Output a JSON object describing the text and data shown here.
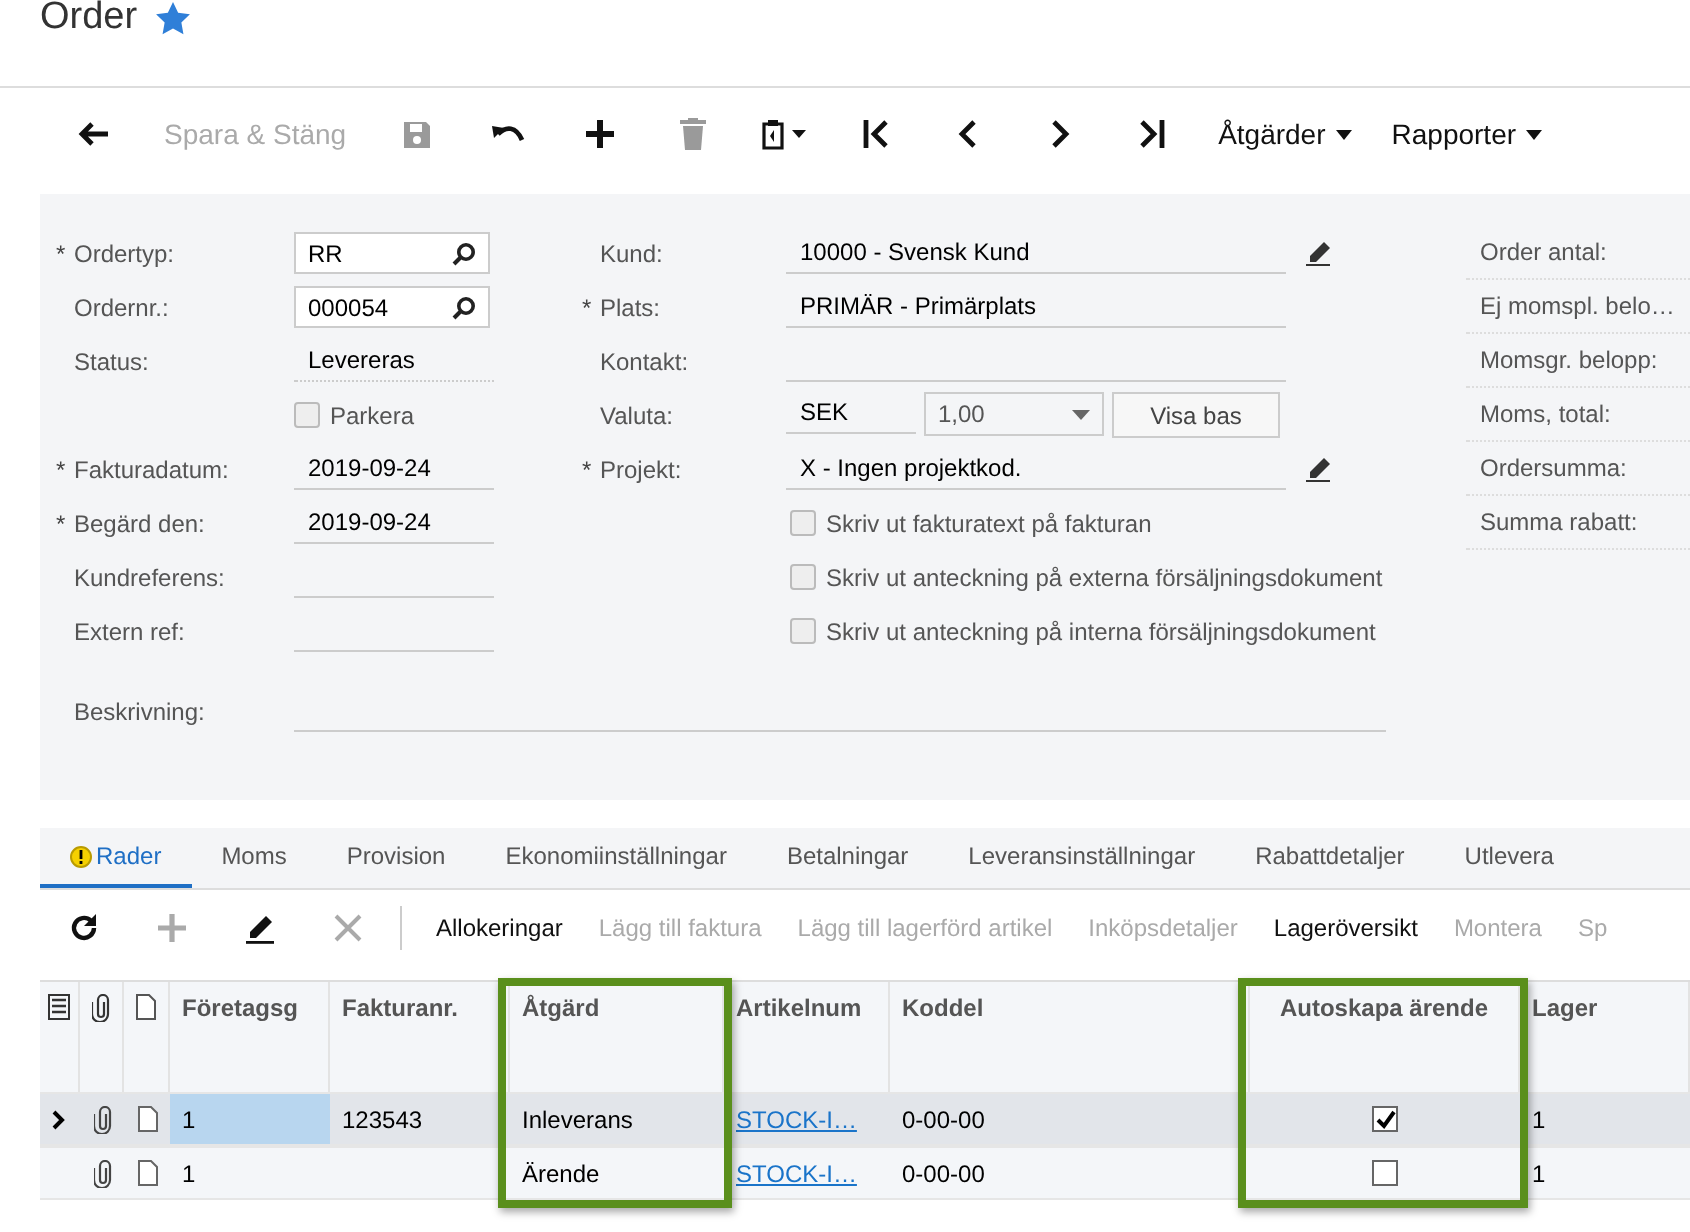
{
  "title": "Order",
  "starred": true,
  "toolbar": [
    {
      "kind": "back",
      "disabled": false
    },
    {
      "kind": "text",
      "label": "Spara & Stäng",
      "disabled": true
    },
    {
      "kind": "save",
      "disabled": true
    },
    {
      "kind": "undo",
      "disabled": false
    },
    {
      "kind": "add",
      "disabled": false
    },
    {
      "kind": "delete",
      "disabled": true
    },
    {
      "kind": "clipboard",
      "disabled": false
    },
    {
      "kind": "first",
      "disabled": false
    },
    {
      "kind": "prev",
      "disabled": false
    },
    {
      "kind": "next",
      "disabled": false
    },
    {
      "kind": "last",
      "disabled": false
    },
    {
      "kind": "menu",
      "label": "Åtgärder",
      "disabled": false
    },
    {
      "kind": "menu",
      "label": "Rapporter",
      "disabled": false
    }
  ],
  "form": {
    "left": [
      {
        "kind": "lookup",
        "label": "Ordertyp:",
        "required": true,
        "value": "RR"
      },
      {
        "kind": "lookup",
        "label": "Ordernr.:",
        "required": false,
        "value": "000054"
      },
      {
        "kind": "readonly",
        "label": "Status:",
        "required": false,
        "value": "Levereras"
      },
      {
        "kind": "checkbox",
        "label": "Parkera",
        "checked": false
      },
      {
        "kind": "input",
        "label": "Fakturadatum:",
        "required": true,
        "value": "2019-09-24"
      },
      {
        "kind": "input",
        "label": "Begärd den:",
        "required": true,
        "value": "2019-09-24"
      },
      {
        "kind": "input",
        "label": "Kundreferens:",
        "required": false
      },
      {
        "kind": "input",
        "label": "Extern ref:",
        "required": false
      }
    ],
    "middle": [
      {
        "kind": "input",
        "label": "Kund:",
        "required": false,
        "value": "10000 - Svensk Kund",
        "editable": true
      },
      {
        "kind": "input",
        "label": "Plats:",
        "required": true,
        "value": "PRIMÄR - Primärplats",
        "editable": false
      },
      {
        "kind": "input",
        "label": "Kontakt:",
        "required": false,
        "editable": false
      },
      {
        "kind": "currency",
        "label": "Valuta:",
        "required": false,
        "value": "SEK",
        "rate": "1,00",
        "button": "Visa bas"
      },
      {
        "kind": "input",
        "label": "Projekt:",
        "required": true,
        "value": "X - Ingen projektkod.",
        "editable": true
      },
      {
        "kind": "checkbox",
        "label": "Skriv ut fakturatext på fakturan",
        "checked": false
      },
      {
        "kind": "checkbox",
        "label": "Skriv ut anteckning på externa försäljningsdokument",
        "checked": false
      },
      {
        "kind": "checkbox",
        "label": "Skriv ut anteckning på interna försäljningsdokument",
        "checked": false
      }
    ],
    "right": [
      "Order antal:",
      "Ej momspl. belo…",
      "Momsgr. belopp:",
      "Moms, total:",
      "Ordersumma:",
      "Summa rabatt:"
    ],
    "description_label": "Beskrivning:",
    "required_marker": "*"
  },
  "tabs": [
    {
      "label": "Rader",
      "selected": true,
      "warning": true
    },
    {
      "label": "Moms",
      "selected": false,
      "warning": false
    },
    {
      "label": "Provision",
      "selected": false,
      "warning": false
    },
    {
      "label": "Ekonomiinställningar",
      "selected": false,
      "warning": false
    },
    {
      "label": "Betalningar",
      "selected": false,
      "warning": false
    },
    {
      "label": "Leveransinställningar",
      "selected": false,
      "warning": false
    },
    {
      "label": "Rabattdetaljer",
      "selected": false,
      "warning": false
    },
    {
      "label": "Utlevera",
      "selected": false,
      "warning": false
    }
  ],
  "grid_toolbar": [
    {
      "kind": "refresh",
      "disabled": false
    },
    {
      "kind": "add",
      "disabled": true
    },
    {
      "kind": "edit",
      "disabled": false
    },
    {
      "kind": "delete",
      "disabled": true
    },
    {
      "kind": "separator"
    },
    {
      "kind": "text",
      "label": "Allokeringar",
      "disabled": false
    },
    {
      "kind": "text",
      "label": "Lägg till faktura",
      "disabled": true
    },
    {
      "kind": "text",
      "label": "Lägg till lagerförd artikel",
      "disabled": true
    },
    {
      "kind": "text",
      "label": "Inköpsdetaljer",
      "disabled": true
    },
    {
      "kind": "text",
      "label": "Lageröversikt",
      "disabled": false
    },
    {
      "kind": "text",
      "label": "Montera",
      "disabled": true
    },
    {
      "kind": "text",
      "label": "Sp",
      "disabled": true
    }
  ],
  "columns": [
    {
      "kind": "settings",
      "highlighted": false
    },
    {
      "kind": "attach",
      "highlighted": false
    },
    {
      "kind": "note",
      "highlighted": false
    },
    {
      "kind": "text",
      "label": "Företagsg",
      "highlighted": false
    },
    {
      "kind": "text",
      "label": "Fakturanr.",
      "highlighted": false
    },
    {
      "kind": "text",
      "label": "Åtgärd",
      "highlighted": true
    },
    {
      "kind": "text",
      "label": "Artikelnum",
      "highlighted": false
    },
    {
      "kind": "text",
      "label": "Koddel",
      "highlighted": false
    },
    {
      "kind": "text",
      "label": "Autoskapa ärende",
      "highlighted": true
    },
    {
      "kind": "text",
      "label": "Lager",
      "highlighted": false
    }
  ],
  "rows": [
    {
      "selected": true,
      "company": "1",
      "invoice": "123543",
      "action": "Inleverans",
      "item": "STOCK-I…",
      "subaccount": "0-00-00",
      "auto_create": true,
      "warehouse": "1"
    },
    {
      "selected": false,
      "company": "1",
      "action": "Ärende",
      "item": "STOCK-I…",
      "subaccount": "0-00-00",
      "auto_create": false,
      "warehouse": "1"
    }
  ]
}
